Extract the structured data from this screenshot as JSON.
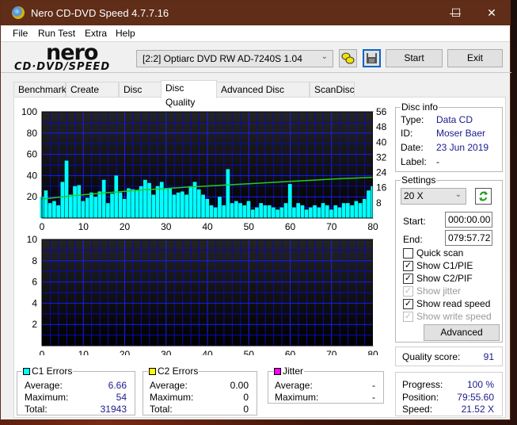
{
  "window": {
    "title": "Nero CD-DVD Speed 4.7.7.16",
    "minimize_glyph": "—",
    "maximize_glyph": "☐",
    "close_glyph": "✕"
  },
  "menu": [
    "File",
    "Run Test",
    "Extra",
    "Help"
  ],
  "logo": {
    "top": "nero",
    "bottom": "CD·DVD/SPEED"
  },
  "toolbar": {
    "drive": "[2:2]   Optiarc DVD RW AD-7240S 1.04",
    "drive_chevron": "⌄",
    "start_label": "Start",
    "exit_label": "Exit",
    "drive_info_icon": "chain-icon",
    "save_icon": "floppy-icon"
  },
  "tabs": [
    {
      "label": "Benchmark",
      "active": false
    },
    {
      "label": "Create Disc",
      "active": false
    },
    {
      "label": "Disc Info",
      "active": false
    },
    {
      "label": "Disc Quality",
      "active": true
    },
    {
      "label": "Advanced Disc Quality",
      "active": false
    },
    {
      "label": "ScanDisc",
      "active": false
    }
  ],
  "disc_info": {
    "title": "Disc info",
    "type_label": "Type:",
    "type": "Data CD",
    "id_label": "ID:",
    "id": "Moser Baer",
    "date_label": "Date:",
    "date": "23 Jun 2019",
    "label_label": "Label:",
    "label": "-"
  },
  "settings": {
    "title": "Settings",
    "speed": "20 X",
    "start_label": "Start:",
    "start": "000:00.00",
    "end_label": "End:",
    "end": "079:57.72",
    "checkboxes": [
      {
        "label": "Quick scan",
        "checked": false,
        "enabled": true
      },
      {
        "label": "Show C1/PIE",
        "checked": true,
        "enabled": true
      },
      {
        "label": "Show C2/PIF",
        "checked": true,
        "enabled": true
      },
      {
        "label": "Show jitter",
        "checked": true,
        "enabled": false
      },
      {
        "label": "Show read speed",
        "checked": true,
        "enabled": true
      },
      {
        "label": "Show write speed",
        "checked": true,
        "enabled": false
      }
    ],
    "advanced_label": "Advanced"
  },
  "quality": {
    "label": "Quality score:",
    "value": "91"
  },
  "progress": {
    "progress_label": "Progress:",
    "progress": "100 %",
    "position_label": "Position:",
    "position": "79:55.60",
    "speed_label": "Speed:",
    "speed": "21.52 X"
  },
  "c1": {
    "title": "C1 Errors",
    "color": "#00ffff",
    "avg_label": "Average:",
    "avg": "6.66",
    "max_label": "Maximum:",
    "max": "54",
    "total_label": "Total:",
    "total": "31943"
  },
  "c2": {
    "title": "C2 Errors",
    "color": "#ffff00",
    "avg_label": "Average:",
    "avg": "0.00",
    "max_label": "Maximum:",
    "max": "0",
    "total_label": "Total:",
    "total": "0"
  },
  "jitter": {
    "title": "Jitter",
    "color": "#ff00ff",
    "avg_label": "Average:",
    "avg": "-",
    "max_label": "Maximum:",
    "max": "-"
  },
  "chart_data": [
    {
      "type": "area",
      "title": "C1 errors and read speed",
      "x_ticks": [
        "0",
        "10",
        "20",
        "30",
        "40",
        "50",
        "60",
        "70",
        "80"
      ],
      "xlim": [
        0,
        80
      ],
      "y_left_ticks": [
        "100",
        "80",
        "60",
        "40",
        "20"
      ],
      "ylim_left": [
        0,
        100
      ],
      "y_right_ticks": [
        "56",
        "48",
        "40",
        "32",
        "24",
        "16",
        "8"
      ],
      "ylim_right": [
        0,
        56
      ],
      "grid": true,
      "series": [
        {
          "name": "C1 Errors",
          "color": "#00ffff",
          "axis": "left",
          "x": [
            0,
            1,
            2,
            3,
            4,
            5,
            6,
            7,
            8,
            9,
            10,
            11,
            12,
            13,
            14,
            15,
            16,
            17,
            18,
            19,
            20,
            21,
            22,
            23,
            24,
            25,
            26,
            27,
            28,
            29,
            30,
            31,
            32,
            33,
            34,
            35,
            36,
            37,
            38,
            39,
            40,
            41,
            42,
            43,
            44,
            45,
            46,
            47,
            48,
            49,
            50,
            51,
            52,
            53,
            54,
            55,
            56,
            57,
            58,
            59,
            60,
            61,
            62,
            63,
            64,
            65,
            66,
            67,
            68,
            69,
            70,
            71,
            72,
            73,
            74,
            75,
            76,
            77,
            78,
            79,
            80
          ],
          "values": [
            20,
            26,
            14,
            16,
            12,
            34,
            54,
            22,
            30,
            31,
            16,
            19,
            24,
            20,
            25,
            36,
            14,
            23,
            40,
            24,
            18,
            28,
            27,
            26,
            30,
            36,
            33,
            22,
            30,
            34,
            28,
            28,
            22,
            24,
            25,
            22,
            30,
            34,
            27,
            22,
            18,
            12,
            10,
            20,
            12,
            46,
            14,
            16,
            14,
            12,
            16,
            8,
            10,
            14,
            12,
            12,
            10,
            8,
            10,
            14,
            32,
            10,
            14,
            12,
            8,
            10,
            12,
            10,
            14,
            12,
            8,
            12,
            10,
            14,
            14,
            12,
            16,
            14,
            18,
            26,
            30
          ]
        },
        {
          "name": "Read speed",
          "color": "#22cc22",
          "axis": "right",
          "x": [
            0,
            5,
            10,
            15,
            20,
            25,
            30,
            35,
            40,
            45,
            50,
            55,
            60,
            65,
            70,
            75,
            80
          ],
          "values": [
            10.0,
            11.2,
            12.3,
            13.2,
            14.1,
            14.9,
            15.6,
            16.3,
            16.9,
            17.5,
            18.1,
            18.7,
            19.3,
            19.9,
            20.5,
            21.0,
            21.5
          ]
        }
      ]
    },
    {
      "type": "bar",
      "title": "C2 errors",
      "x_ticks": [
        "0",
        "10",
        "20",
        "30",
        "40",
        "50",
        "60",
        "70",
        "80"
      ],
      "xlim": [
        0,
        80
      ],
      "y_ticks": [
        "10",
        "8",
        "6",
        "4",
        "2"
      ],
      "ylim": [
        0,
        10
      ],
      "grid": true,
      "series": [
        {
          "name": "C2 Errors",
          "color": "#ffff00",
          "values": []
        }
      ]
    }
  ]
}
